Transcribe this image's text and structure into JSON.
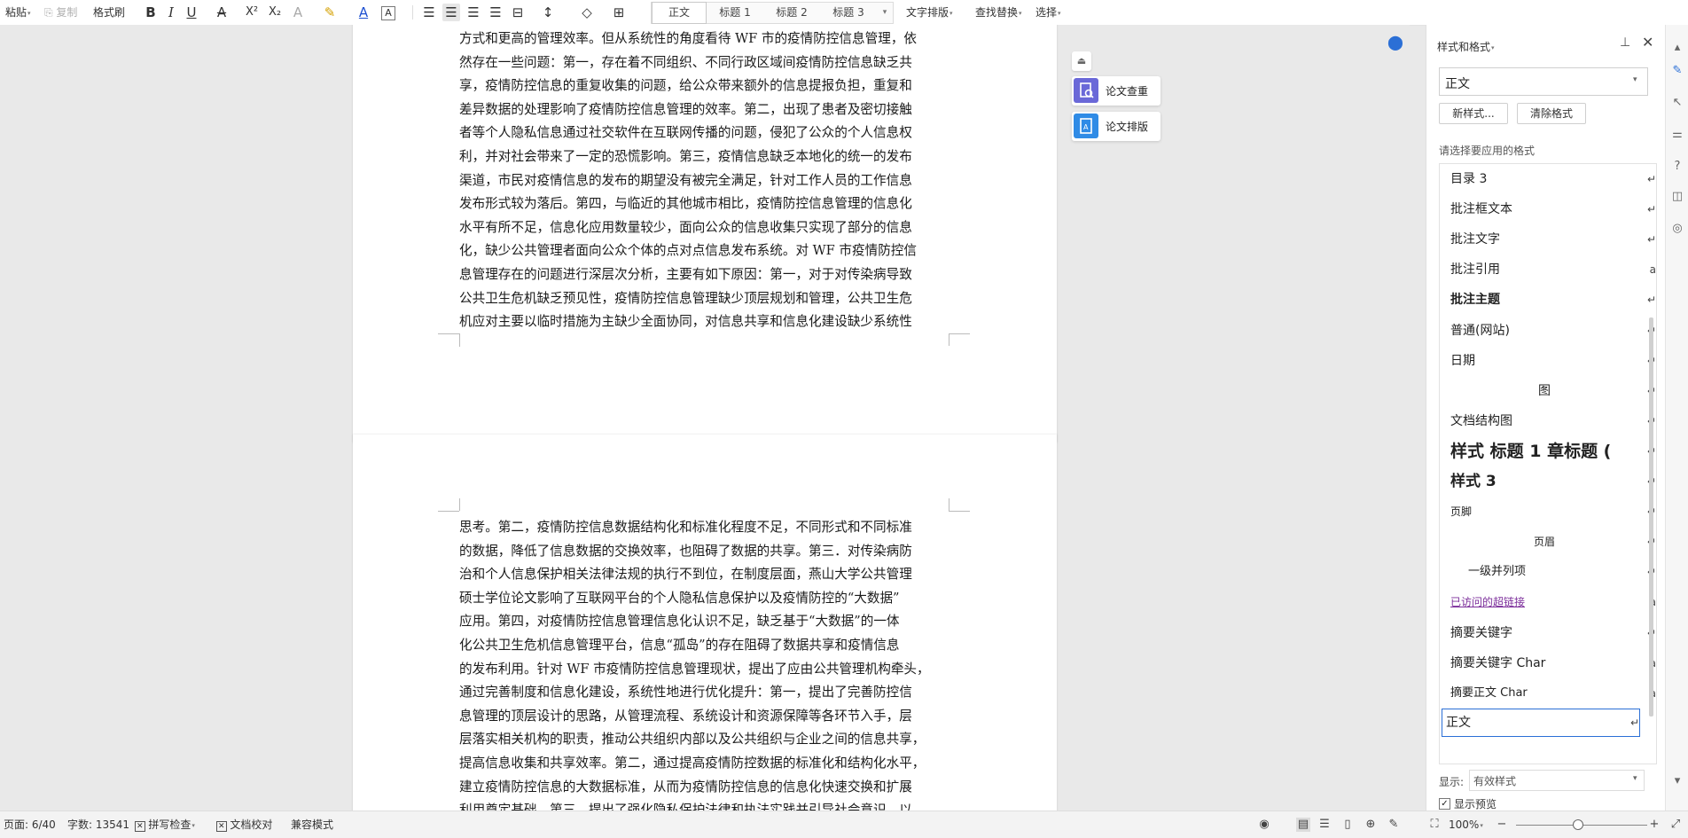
{
  "toolbar": {
    "paste": "粘贴",
    "copy": "复制",
    "format_painter": "格式刷",
    "styles": [
      "正文",
      "标题 1",
      "标题 2",
      "标题 3"
    ],
    "text_layout": "文字排版",
    "find_replace": "查找替换",
    "select": "选择"
  },
  "document": {
    "page1_lines": [
      "方式和更高的管理效率。但从系统性的角度看待 WF 市的疫情防控信息管理，依",
      "然存在一些问题：第一，存在着不同组织、不同行政区域间疫情防控信息缺乏共",
      "享，疫情防控信息的重复收集的问题，给公众带来额外的信息提报负担，重复和",
      "差异数据的处理影响了疫情防控信息管理的效率。第二，出现了患者及密切接触",
      "者等个人隐私信息通过社交软件在互联网传播的问题，侵犯了公众的个人信息权",
      "利，并对社会带来了一定的恐慌影响。第三，疫情信息缺乏本地化的统一的发布",
      "渠道，市民对疫情信息的发布的期望没有被完全满足，针对工作人员的工作信息",
      "发布形式较为落后。第四，与临近的其他城市相比，疫情防控信息管理的信息化",
      "水平有所不足，信息化应用数量较少，面向公众的信息收集只实现了部分的信息",
      "化，缺少公共管理者面向公众个体的点对点信息发布系统。对 WF 市疫情防控信",
      "息管理存在的问题进行深层次分析，主要有如下原因：第一，对于对传染病导致",
      "公共卫生危机缺乏预见性，疫情防控信息管理缺少顶层规划和管理，公共卫生危",
      "机应对主要以临时措施为主缺少全面协同，对信息共享和信息化建设缺少系统性"
    ],
    "page2_lines": [
      "思考。第二，疫情防控信息数据结构化和标准化程度不足，不同形式和不同标准",
      "的数据，降低了信息数据的交换效率，也阻碍了数据的共享。第三．对传染病防",
      "治和个人信息保护相关法律法规的执行不到位，在制度层面，燕山大学公共管理",
      "硕士学位论文影响了互联网平台的个人隐私信息保护以及疫情防控的“大数据”",
      "应用。第四，对疫情防控信息管理信息化认识不足，缺乏基于“大数据”的一体",
      "化公共卫生危机信息管理平台，信息“孤岛”的存在阻碍了数据共享和疫情信息",
      "的发布利用。针对 WF 市疫情防控信息管理现状，提出了应由公共管理机构牵头，",
      "通过完善制度和信息化建设，系统性地进行优化提升：第一，提出了完善防控信",
      "息管理的顶层设计的思路，从管理流程、系统设计和资源保障等各环节入手，层",
      "层落实相关机构的职责，推动公共组织内部以及公共组织与企业之间的信息共享，",
      "提高信息收集和共享效率。第二，通过提高疫情防控数据的标准化和结构化水平，",
      "建立疫情防控信息的大数据标准，从而为疫情防控信息的信息化快速交换和扩展",
      "利用奠定基础。第三，提出了强化隐私保护法律和执法实践并引导社会意识，以"
    ]
  },
  "float_buttons": {
    "check": "论文查重",
    "layout": "论文排版"
  },
  "side_panel": {
    "title": "样式和格式",
    "current_style": "正文",
    "new_style": "新样式...",
    "clear_format": "清除格式",
    "prompt": "请选择要应用的格式",
    "styles": [
      {
        "label": "目录 3",
        "mark": "↵"
      },
      {
        "label": "批注框文本",
        "mark": "↵"
      },
      {
        "label": "批注文字",
        "mark": "↵"
      },
      {
        "label": "批注引用",
        "mark": "a"
      },
      {
        "label": "批注主题",
        "mark": "↵"
      },
      {
        "label": "普通(网站)",
        "mark": "↵"
      },
      {
        "label": "日期",
        "mark": "↵"
      },
      {
        "label": "图",
        "mark": "↵"
      },
      {
        "label": "文档结构图",
        "mark": "↵"
      },
      {
        "label": "样式 标题 1 章标题 (",
        "mark": "↵"
      },
      {
        "label": "样式 3",
        "mark": "↵"
      },
      {
        "label": "页脚",
        "mark": "↵"
      },
      {
        "label": "页眉",
        "mark": "↵"
      },
      {
        "label": "一级并列项",
        "mark": "↵"
      },
      {
        "label": "已访问的超链接",
        "mark": "a"
      },
      {
        "label": "摘要关键字",
        "mark": "↵"
      },
      {
        "label": "摘要关键字 Char",
        "mark": "a"
      },
      {
        "label": "摘要正文 Char",
        "mark": "a"
      },
      {
        "label": "正文",
        "mark": "↵"
      }
    ],
    "show_label": "显示:",
    "show_value": "有效样式",
    "show_preview": "显示预览"
  },
  "status_bar": {
    "page": "页面: 6/40",
    "word_count": "字数: 13541",
    "spell_check": "拼写检查",
    "doc_proof": "文档校对",
    "compat_mode": "兼容模式",
    "zoom": "100%"
  },
  "colors": {
    "accent_blue": "#2b6fd6",
    "float_purple": "#6a68d8",
    "float_blue": "#2f8be6",
    "link_purple": "#7b2d9a"
  }
}
